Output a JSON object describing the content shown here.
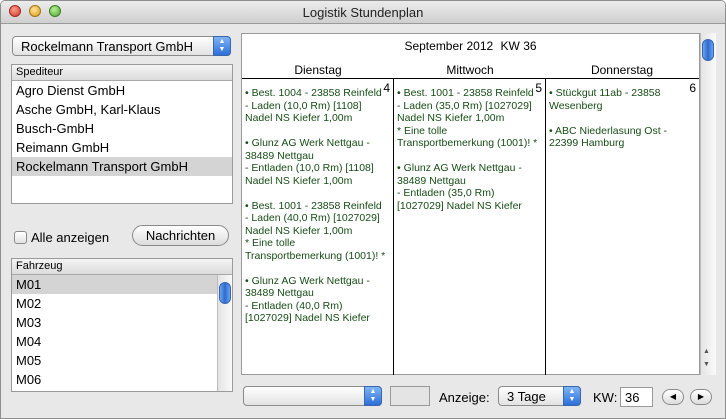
{
  "window": {
    "title": "Logistik Stundenplan"
  },
  "spediteur_popup": {
    "value": "Rockelmann Transport GmbH"
  },
  "spediteur_list": {
    "header": "Spediteur",
    "items": [
      "Agro Dienst GmbH",
      "Asche GmbH, Karl-Klaus",
      "Busch-GmbH",
      "Reimann GmbH",
      "Rockelmann Transport GmbH"
    ],
    "selected": "Rockelmann Transport GmbH"
  },
  "all_checkbox": {
    "label": "Alle anzeigen",
    "checked": false
  },
  "messages_button": {
    "label": "Nachrichten"
  },
  "fahrzeug_list": {
    "header": "Fahrzeug",
    "items": [
      "M01",
      "M02",
      "M03",
      "M04",
      "M05",
      "M06"
    ],
    "selected": "M01"
  },
  "calendar": {
    "month": "September 2012",
    "week_label": "KW 36",
    "days": [
      {
        "name": "Dienstag",
        "number": "4",
        "entries": [
          "• Best. 1004 - 23858 Reinfeld\n  - Laden (10,0 Rm) [1108]\nNadel NS Kiefer 1,00m",
          "• Glunz AG Werk Nettgau -\n38489 Nettgau\n  - Entladen (10,0 Rm) [1108]\nNadel NS Kiefer 1,00m",
          "• Best. 1001 - 23858 Reinfeld\n  - Laden (40,0 Rm) [1027029]\nNadel NS Kiefer 1,00m\n* Eine tolle\nTransportbemerkung (1001)! *",
          "• Glunz AG Werk Nettgau -\n38489 Nettgau\n  - Entladen (40,0 Rm)\n[1027029] Nadel NS Kiefer"
        ]
      },
      {
        "name": "Mittwoch",
        "number": "5",
        "entries": [
          "• Best. 1001 - 23858 Reinfeld\n  - Laden (35,0 Rm) [1027029]\nNadel NS Kiefer 1,00m\n* Eine tolle\nTransportbemerkung (1001)! *",
          "• Glunz AG Werk Nettgau -\n38489 Nettgau\n  - Entladen (35,0 Rm)\n[1027029] Nadel NS Kiefer"
        ]
      },
      {
        "name": "Donnerstag",
        "number": "6",
        "entries": [
          "• Stückgut 11ab - 23858\nWesenberg",
          "• ABC Niederlasung Ost -\n22399 Hamburg"
        ]
      }
    ],
    "entry_color": "#174d17"
  },
  "bottom": {
    "left_popup_value": "",
    "anzeige_label": "Anzeige:",
    "anzeige_value": "3 Tage",
    "kw_label": "KW:",
    "kw_value": "36"
  },
  "accent_color": "#2d6fd8"
}
